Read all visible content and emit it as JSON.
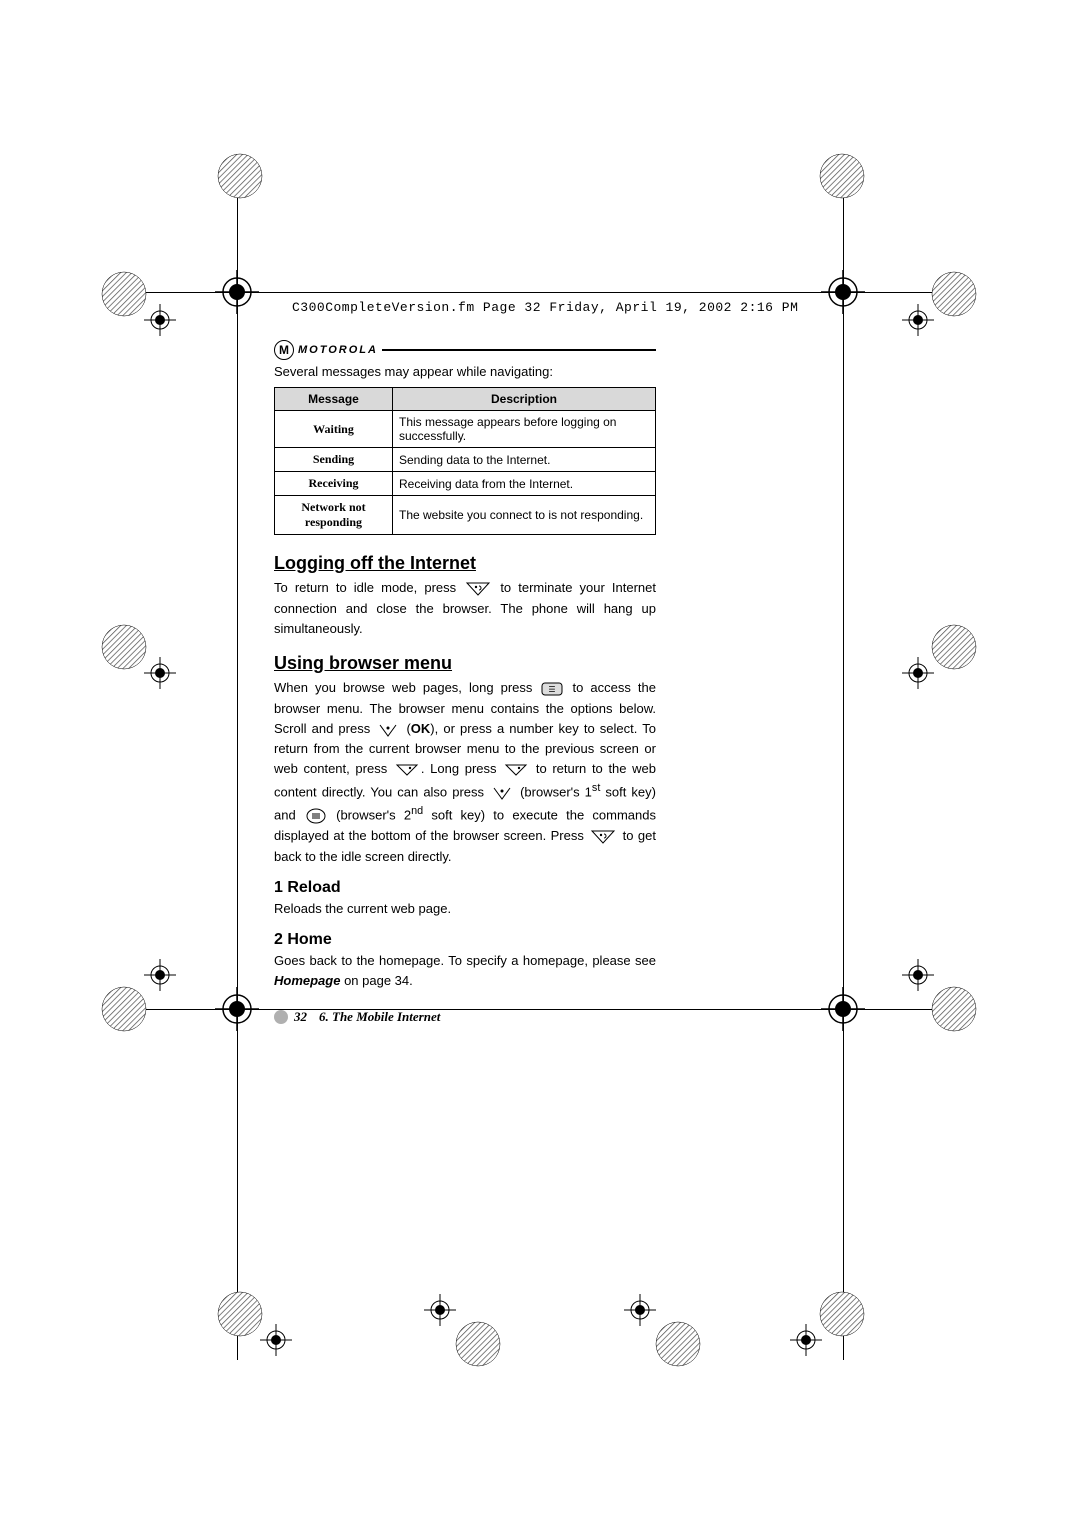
{
  "file_header": "C300CompleteVersion.fm  Page 32  Friday, April 19, 2002  2:16 PM",
  "brand": {
    "logo_letter": "M",
    "name": "MOTOROLA"
  },
  "intro": "Several messages may appear while navigating:",
  "table": {
    "headers": {
      "message": "Message",
      "description": "Description"
    },
    "rows": [
      {
        "label": "Waiting",
        "desc": "This message appears before logging on successfully."
      },
      {
        "label": "Sending",
        "desc": "Sending data to the Internet."
      },
      {
        "label": "Receiving",
        "desc": "Receiving data from the Internet."
      },
      {
        "label": "Network not responding",
        "desc": "The website you connect to is not responding."
      }
    ]
  },
  "section_logoff": {
    "title": "Logging off the Internet",
    "p1a": "To return to idle mode, press ",
    "p1b": " to terminate your Internet connection and close the browser. The phone will hang up simultaneously."
  },
  "section_browser": {
    "title": "Using browser menu",
    "p1a": "When you browse web pages, long press ",
    "p1b": " to access the browser menu. The browser menu contains the options below. Scroll and press ",
    "ok": "OK",
    "p1c": "), or press a number key to select. To return from the current browser menu to the previous screen or web content, press ",
    "p1d": ". Long press ",
    "p1e": " to return to the web content directly. You can also press ",
    "p1f": " (browser's 1",
    "sup_st": "st",
    "p1g": " soft key) and ",
    "p1h": " (browser's 2",
    "sup_nd": "nd",
    "p1i": " soft key) to execute the commands displayed at the bottom of the browser screen. Press ",
    "p1j": " to get back to the idle screen directly."
  },
  "sub_reload": {
    "title": "1 Reload",
    "body": "Reloads the current web page."
  },
  "sub_home": {
    "title": "2 Home",
    "body_a": "Goes back to the homepage. To specify a homepage, please see ",
    "link": "Homepage",
    "body_b": " on page 34."
  },
  "footer": {
    "page": "32",
    "chapter": "6. The Mobile Internet"
  }
}
